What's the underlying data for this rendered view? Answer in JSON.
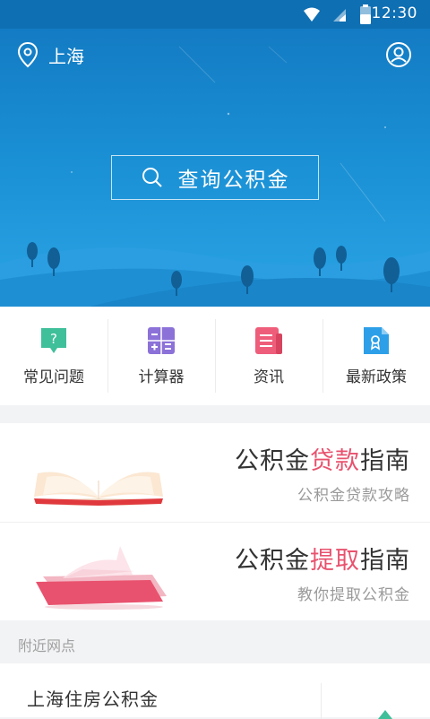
{
  "status_bar": {
    "time": "12:30"
  },
  "header": {
    "city": "上海"
  },
  "search": {
    "placeholder": "查询公积金"
  },
  "quick_menu": [
    {
      "label": "常见问题",
      "icon": "question-bubble-icon",
      "color": "#3fbf9a"
    },
    {
      "label": "计算器",
      "icon": "calculator-icon",
      "color": "#8b71d8"
    },
    {
      "label": "资讯",
      "icon": "news-icon",
      "color": "#ee5d7a"
    },
    {
      "label": "最新政策",
      "icon": "policy-document-icon",
      "color": "#2d9fe8"
    }
  ],
  "guides": [
    {
      "title_pre": "公积金",
      "title_hl": "贷款",
      "title_post": "指南",
      "subtitle": "公积金贷款攻略",
      "icon": "open-book-icon"
    },
    {
      "title_pre": "公积金",
      "title_hl": "提取",
      "title_post": "指南",
      "subtitle": "教你提取公积金",
      "icon": "phone-tray-icon"
    }
  ],
  "nearby": {
    "section_label": "附近网点",
    "items": [
      {
        "name": "上海住房公积金"
      }
    ]
  },
  "colors": {
    "primary": "#1a8fd4",
    "highlight": "#e8526e"
  }
}
